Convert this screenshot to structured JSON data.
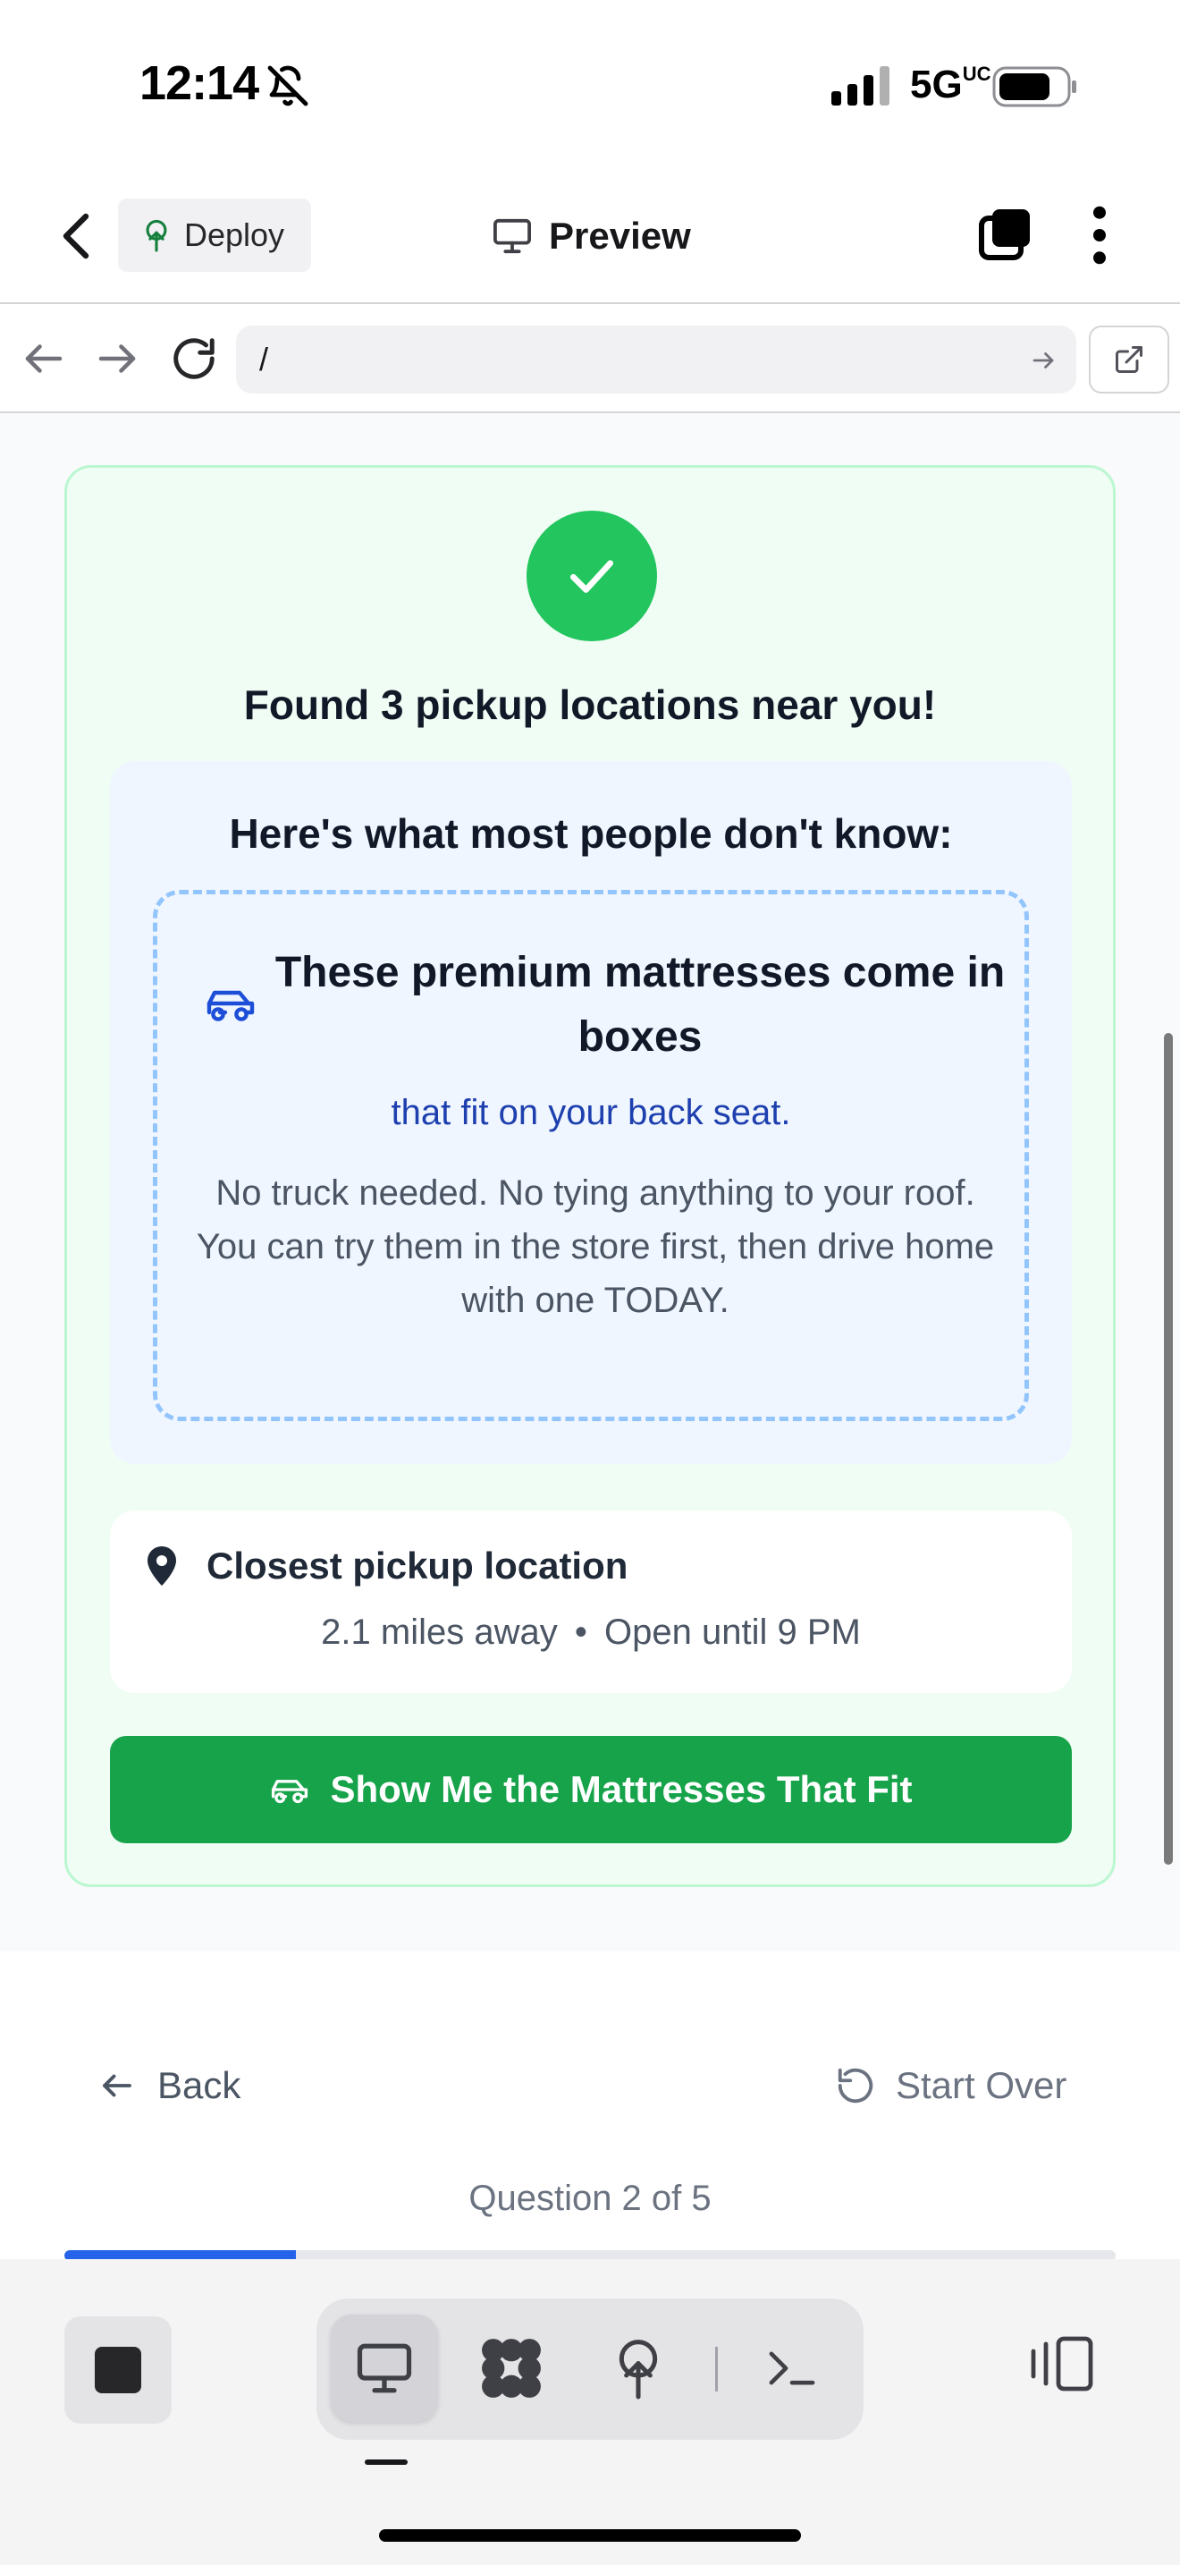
{
  "status_bar": {
    "time": "12:14",
    "network": "5G",
    "network_suffix": "UC"
  },
  "header": {
    "deploy_label": "Deploy",
    "preview_label": "Preview"
  },
  "url_bar": {
    "path": "/"
  },
  "result": {
    "title": "Found 3 pickup locations near you!",
    "info_heading": "Here's what most people don't know:",
    "premium_text": "These premium mattresses come in boxes",
    "backseat_text": "that fit on your back seat.",
    "desc_line1": "No truck needed. No tying anything to your roof.",
    "desc_line2": "You can try them in the store first, then drive home with one TODAY."
  },
  "pickup": {
    "title": "Closest pickup location",
    "distance": "2.1 miles away",
    "separator": "•",
    "hours": "Open until 9 PM"
  },
  "cta": {
    "label": "Show Me the Mattresses That Fit"
  },
  "nav": {
    "back_label": "Back",
    "start_over_label": "Start Over"
  },
  "progress": {
    "label": "Question 2 of 5",
    "current": 2,
    "total": 5,
    "fill_fraction": 0.22
  },
  "colors": {
    "accent_green": "#22c55e",
    "button_green": "#16a34a",
    "progress_blue": "#2563eb",
    "highlight_blue": "#1e40af"
  },
  "icons": [
    "bell-off-icon",
    "signal-icon",
    "battery-icon",
    "chevron-left-icon",
    "deploy-tree-icon",
    "monitor-icon",
    "tabs-icon",
    "more-vertical-icon",
    "arrow-left-icon",
    "arrow-right-icon",
    "reload-icon",
    "external-link-icon",
    "check-icon",
    "car-icon",
    "map-pin-icon",
    "rotate-ccw-icon",
    "stop-icon",
    "grid-icon",
    "terminal-icon",
    "panel-icon"
  ]
}
